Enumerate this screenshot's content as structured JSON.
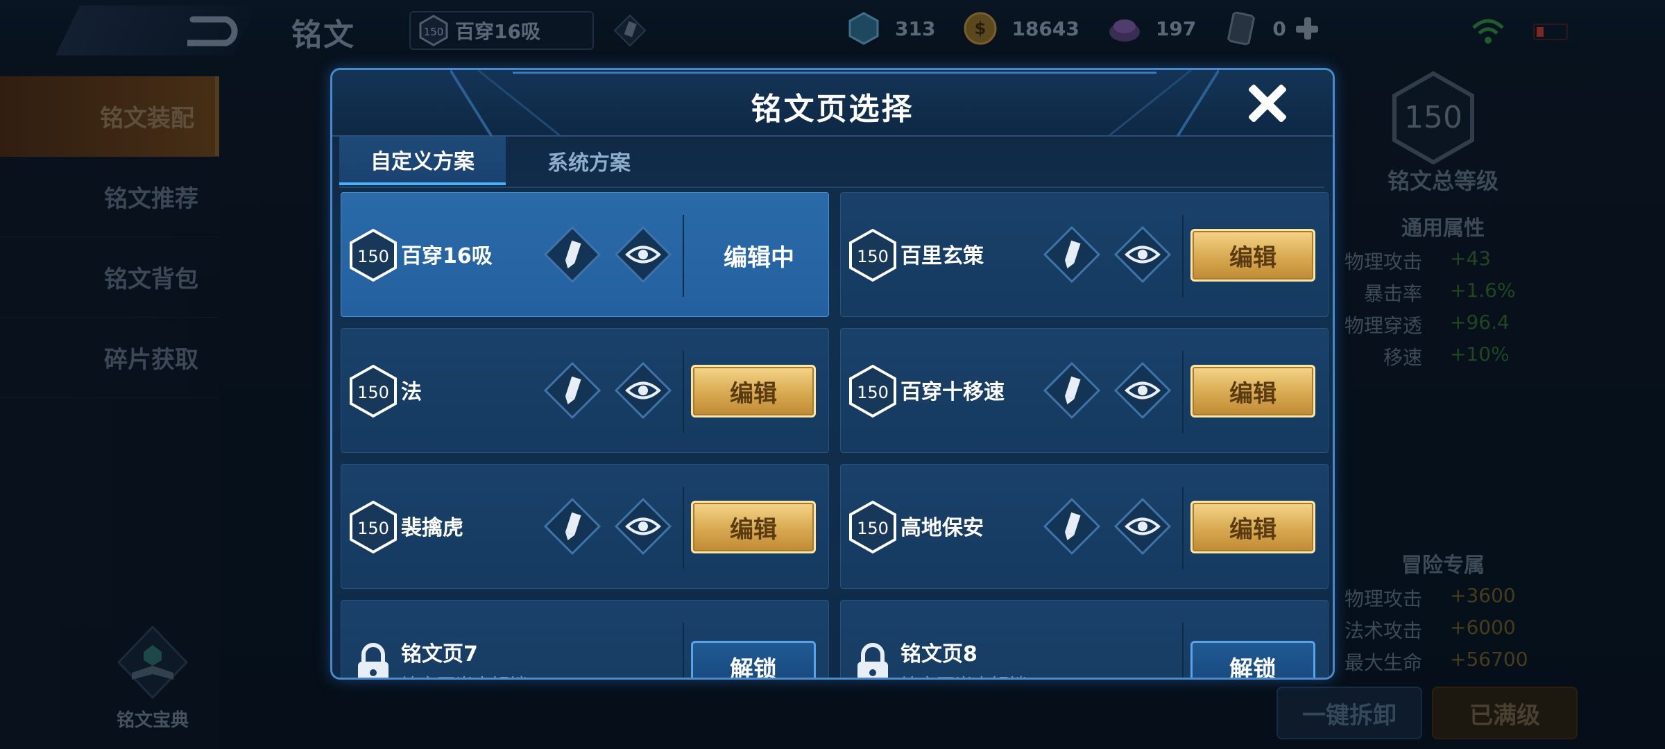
{
  "topbar": {
    "title": "铭文",
    "current_page_level": "150",
    "current_page_name": "百穿16吸",
    "currencies": [
      {
        "icon": "gem-crystal-icon",
        "value": "313"
      },
      {
        "icon": "gold-coin-icon",
        "value": "18643"
      },
      {
        "icon": "purple-crystal-icon",
        "value": "197"
      },
      {
        "icon": "card-ticket-icon",
        "value": "0"
      }
    ]
  },
  "left_nav": {
    "items": [
      {
        "label": "铭文装配",
        "active": true
      },
      {
        "label": "铭文推荐",
        "active": false
      },
      {
        "label": "铭文背包",
        "active": false
      },
      {
        "label": "碎片获取",
        "active": false
      }
    ],
    "codex_label": "铭文宝典"
  },
  "right_panel": {
    "total_level": "150",
    "total_label": "铭文总等级",
    "general_title": "通用属性",
    "general_stats": [
      {
        "k": "物理攻击",
        "v": "+43"
      },
      {
        "k": "暴击率",
        "v": "+1.6%"
      },
      {
        "k": "物理穿透",
        "v": "+96.4"
      },
      {
        "k": "移速",
        "v": "+10%"
      }
    ],
    "adventure_title": "冒险专属",
    "adventure_stats": [
      {
        "k": "物理攻击",
        "v": "+3600"
      },
      {
        "k": "法术攻击",
        "v": "+6000"
      },
      {
        "k": "最大生命",
        "v": "+56700"
      }
    ],
    "dismantle_label": "一键拆卸",
    "maxed_label": "已满级"
  },
  "modal": {
    "title": "铭文页选择",
    "tabs": [
      {
        "label": "自定义方案",
        "active": true
      },
      {
        "label": "系统方案",
        "active": false
      }
    ],
    "pages": [
      {
        "level": "150",
        "name": "百穿16吸",
        "status": "编辑中",
        "editing": true
      },
      {
        "level": "150",
        "name": "百里玄策",
        "action": "编辑"
      },
      {
        "level": "150",
        "name": "法",
        "action": "编辑"
      },
      {
        "level": "150",
        "name": "百穿十移速",
        "action": "编辑"
      },
      {
        "level": "150",
        "name": "裴擒虎",
        "action": "编辑"
      },
      {
        "level": "150",
        "name": "高地保安",
        "action": "编辑"
      },
      {
        "name": "铭文页7",
        "sub": "铭文页尚未解锁",
        "action": "解锁",
        "locked": true
      },
      {
        "name": "铭文页8",
        "sub": "铭文页尚未解锁",
        "action": "解锁",
        "locked": true
      }
    ]
  },
  "colors": {
    "accent_blue": "#46b2ff",
    "gold_button": "#d8a950",
    "active_card": "#2a6aa8"
  }
}
